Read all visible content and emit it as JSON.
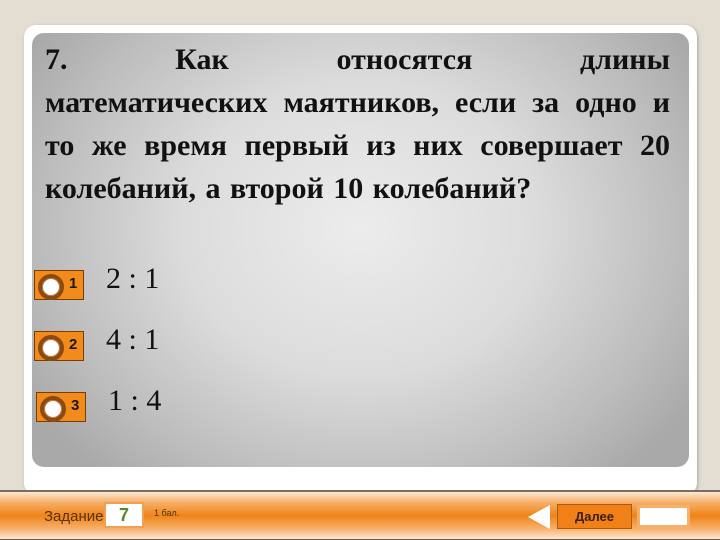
{
  "question": {
    "first_line": "7. Как относятся длины",
    "rest": "математических маятников, если за одно и то же время первый из них совершает 20 колебаний, а второй 10 колебаний?"
  },
  "options": [
    {
      "number": "1",
      "text": "2 : 1"
    },
    {
      "number": "2",
      "text": "4 : 1"
    },
    {
      "number": "3",
      "text": "1 : 4"
    }
  ],
  "footer": {
    "task_label": "Задание",
    "task_number": "7",
    "points": "1 бал.",
    "next_label": "Далее",
    "answer_value": ""
  },
  "colors": {
    "accent_orange": "#f08018",
    "background": "#e4ddd2",
    "task_number": "#5a8a2a"
  }
}
